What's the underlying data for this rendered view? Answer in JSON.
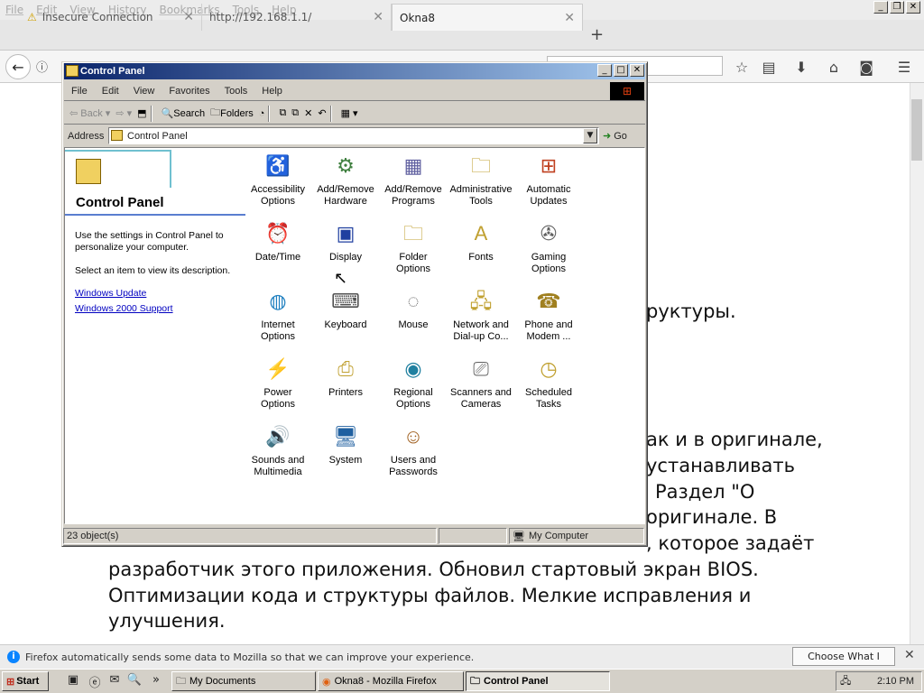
{
  "firefox": {
    "menu": [
      "File",
      "Edit",
      "View",
      "History",
      "Bookmarks",
      "Tools",
      "Help"
    ],
    "tabs": [
      {
        "label": "Insecure Connection"
      },
      {
        "label": "http://192.168.1.1/"
      },
      {
        "label": "Okna8"
      }
    ],
    "page_lines": [
      "руктуры.",
      "ак и в оригинале,",
      "устанавливать",
      "Раздел \"О",
      "оригинале. В",
      ", которое задаёт",
      "разработчик этого приложения. Обновил стартовый экран BIOS.",
      "Оптимизации кода и структуры файлов. Мелкие исправления и",
      "улучшения."
    ],
    "notification": "Firefox automatically sends some data to Mozilla so that we can improve your experience.",
    "share_button": "Choose What I Share"
  },
  "control_panel": {
    "title": "Control Panel",
    "menu": [
      "File",
      "Edit",
      "View",
      "Favorites",
      "Tools",
      "Help"
    ],
    "toolbar": {
      "back": "Back",
      "search": "Search",
      "folders": "Folders"
    },
    "address_label": "Address",
    "address_value": "Control Panel",
    "go": "Go",
    "left": {
      "title": "Control Panel",
      "desc1": "Use the settings in Control Panel to personalize your computer.",
      "desc2": "Select an item to view its description.",
      "link1": "Windows Update",
      "link2": "Windows 2000 Support"
    },
    "items": [
      {
        "l1": "Accessibility",
        "l2": "Options",
        "icon": "accessibility-icon",
        "glyph": "♿",
        "color": "#2050c0"
      },
      {
        "l1": "Add/Remove",
        "l2": "Hardware",
        "icon": "hardware-icon",
        "glyph": "⚙",
        "color": "#408040"
      },
      {
        "l1": "Add/Remove",
        "l2": "Programs",
        "icon": "programs-icon",
        "glyph": "▦",
        "color": "#6060a0"
      },
      {
        "l1": "Administrative",
        "l2": "Tools",
        "icon": "admin-tools-icon",
        "glyph": "🗀",
        "color": "#c0a030"
      },
      {
        "l1": "Automatic",
        "l2": "Updates",
        "icon": "windows-update-icon",
        "glyph": "⊞",
        "color": "#c04020"
      },
      {
        "l1": "Date/Time",
        "l2": "",
        "icon": "date-time-icon",
        "glyph": "⏰",
        "color": "#a02020"
      },
      {
        "l1": "Display",
        "l2": "",
        "icon": "display-icon",
        "glyph": "▣",
        "color": "#2040a0"
      },
      {
        "l1": "Folder Options",
        "l2": "",
        "icon": "folder-options-icon",
        "glyph": "🗀",
        "color": "#c0a030"
      },
      {
        "l1": "Fonts",
        "l2": "",
        "icon": "fonts-icon",
        "glyph": "A",
        "color": "#c0a030"
      },
      {
        "l1": "Gaming",
        "l2": "Options",
        "icon": "gaming-icon",
        "glyph": "✇",
        "color": "#606060"
      },
      {
        "l1": "Internet",
        "l2": "Options",
        "icon": "internet-icon",
        "glyph": "◍",
        "color": "#2080c0"
      },
      {
        "l1": "Keyboard",
        "l2": "",
        "icon": "keyboard-icon",
        "glyph": "⌨",
        "color": "#505050"
      },
      {
        "l1": "Mouse",
        "l2": "",
        "icon": "mouse-icon",
        "glyph": "◌",
        "color": "#707070"
      },
      {
        "l1": "Network and",
        "l2": "Dial-up Co...",
        "icon": "network-icon",
        "glyph": "🖧",
        "color": "#c0a030"
      },
      {
        "l1": "Phone and",
        "l2": "Modem ...",
        "icon": "phone-icon",
        "glyph": "☎",
        "color": "#a08020"
      },
      {
        "l1": "Power Options",
        "l2": "",
        "icon": "power-icon",
        "glyph": "⚡",
        "color": "#808080"
      },
      {
        "l1": "Printers",
        "l2": "",
        "icon": "printers-icon",
        "glyph": "⎙",
        "color": "#c0a030"
      },
      {
        "l1": "Regional",
        "l2": "Options",
        "icon": "globe-icon",
        "glyph": "◉",
        "color": "#2080a0"
      },
      {
        "l1": "Scanners and",
        "l2": "Cameras",
        "icon": "scanner-icon",
        "glyph": "⎚",
        "color": "#606060"
      },
      {
        "l1": "Scheduled",
        "l2": "Tasks",
        "icon": "scheduled-tasks-icon",
        "glyph": "◷",
        "color": "#c0a030"
      },
      {
        "l1": "Sounds and",
        "l2": "Multimedia",
        "icon": "sound-icon",
        "glyph": "🔊",
        "color": "#c0a030"
      },
      {
        "l1": "System",
        "l2": "",
        "icon": "computer-icon",
        "glyph": "🖥",
        "color": "#2060a0"
      },
      {
        "l1": "Users and",
        "l2": "Passwords",
        "icon": "users-icon",
        "glyph": "☺",
        "color": "#a06020"
      }
    ],
    "status_count": "23 object(s)",
    "status_location": "My Computer"
  },
  "taskbar": {
    "start": "Start",
    "buttons": [
      "My Documents",
      "Okna8 - Mozilla Firefox",
      "Control Panel"
    ],
    "clock": "2:10 PM"
  }
}
